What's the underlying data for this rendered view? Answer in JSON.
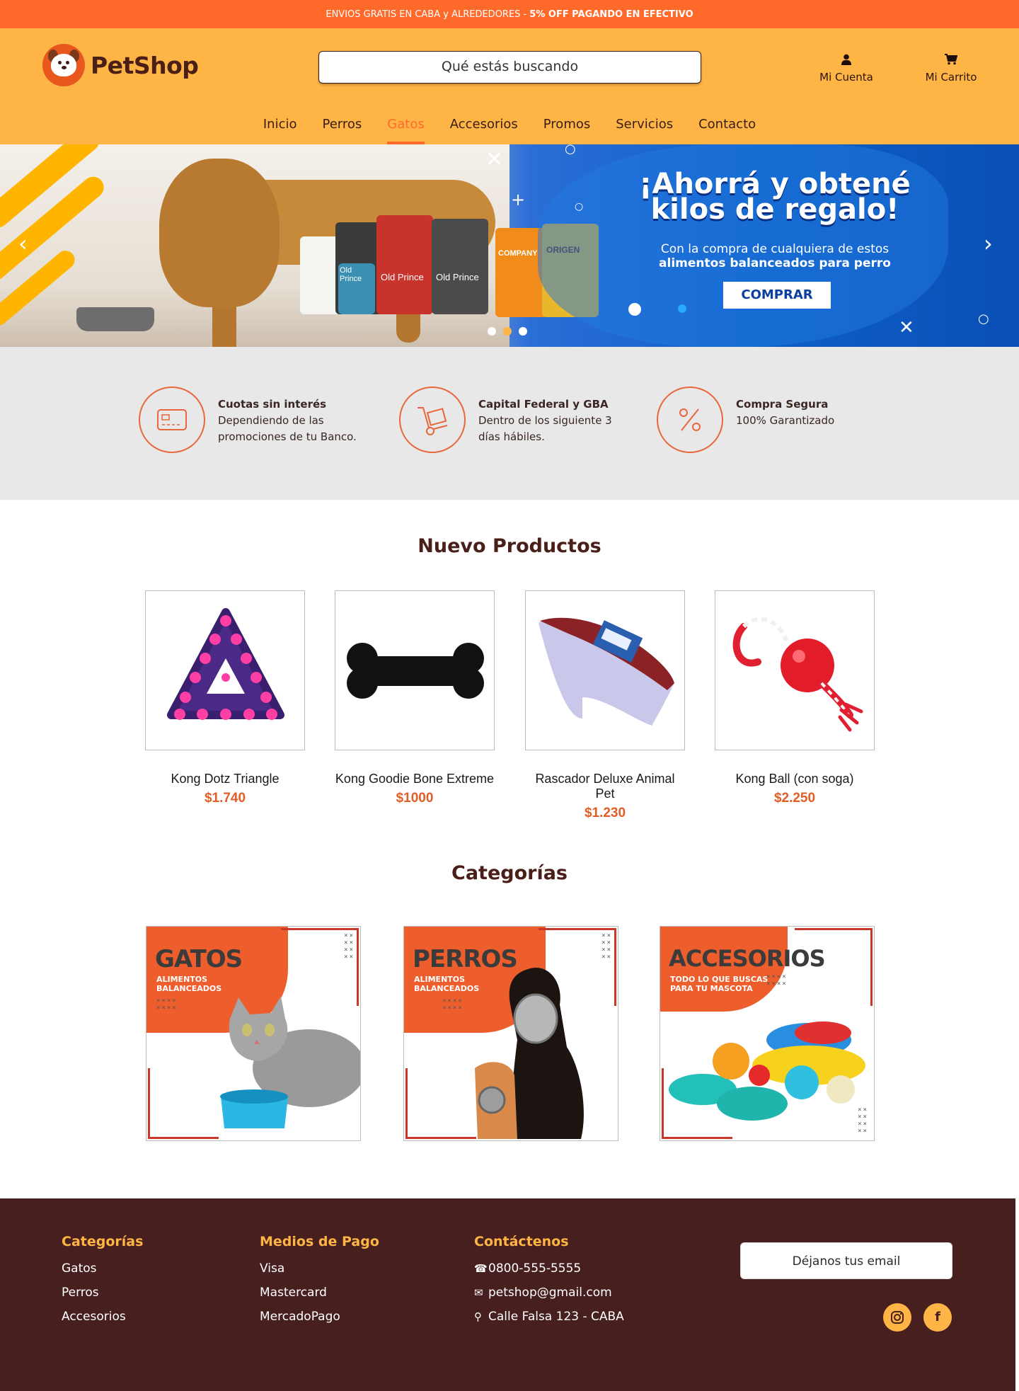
{
  "topbar": {
    "text": "ENVIOS GRATIS EN CABA y ALREDEDORES -",
    "bold": "5% OFF PAGANDO EN EFECTIVO"
  },
  "header": {
    "logo_text": "PetShop",
    "search_placeholder": "Qué estás buscando",
    "account_label": "Mi Cuenta",
    "cart_label": "Mi Carrito",
    "account_icon": "user-icon",
    "cart_icon": "shopping-cart-icon"
  },
  "nav": {
    "items": [
      {
        "label": "Inicio",
        "active": false
      },
      {
        "label": "Perros",
        "active": false
      },
      {
        "label": "Gatos",
        "active": true
      },
      {
        "label": "Accesorios",
        "active": false
      },
      {
        "label": "Promos",
        "active": false
      },
      {
        "label": "Servicios",
        "active": false
      },
      {
        "label": "Contacto",
        "active": false
      }
    ]
  },
  "banner": {
    "headline": "¡Ahorrá y obtené kilos de regalo!",
    "subline": "Con la compra de cualquiera de estos",
    "subline_bold": "alimentos balanceados para perro",
    "button": "COMPRAR",
    "prev_icon": "chevron-left-icon",
    "next_icon": "chevron-right-icon",
    "slides": 3,
    "active_slide": 2,
    "bag_labels": [
      "Old Prince",
      "Old Prince",
      "Old Prince",
      "COMPANY",
      "ORIGEN"
    ]
  },
  "features": [
    {
      "title": "Cuotas sin interés",
      "line1": "Dependiendo de las",
      "line2": "promociones de tu Banco.",
      "icon": "credit-card-icon"
    },
    {
      "title": "Capital Federal y GBA",
      "line1": "Dentro de los siguiente 3",
      "line2": "días hábiles.",
      "icon": "hand-truck-icon"
    },
    {
      "title": "Compra Segura",
      "line1": "100% Garantizado",
      "line2": "",
      "icon": "percent-icon"
    }
  ],
  "products": {
    "title": "Nuevo Productos",
    "items": [
      {
        "name": "Kong Dotz Triangle",
        "price": "$1.740"
      },
      {
        "name": "Kong Goodie Bone Extreme",
        "price": "$1000"
      },
      {
        "name": "Rascador Deluxe Animal Pet",
        "price": "$1.230"
      },
      {
        "name": "Kong Ball (con soga)",
        "price": "$2.250"
      }
    ]
  },
  "categories": {
    "title": "Categorías",
    "items": [
      {
        "big": "GATOS",
        "small": "ALIMENTOS BALANCEADOS"
      },
      {
        "big": "PERROS",
        "small": "ALIMENTOS BALANCEADOS"
      },
      {
        "big": "ACCESORIOS",
        "small": "TODO LO QUE BUSCAS PARA TU MASCOTA"
      }
    ]
  },
  "footer": {
    "cat_title": "Categorías",
    "cat_links": [
      "Gatos",
      "Perros",
      "Accesorios"
    ],
    "pay_title": "Medios de Pago",
    "pay_links": [
      "Visa",
      "Mastercard",
      "MercadoPago"
    ],
    "contact_title": "Contáctenos",
    "phone": "0800-555-5555",
    "email": "petshop@gmail.com",
    "address": "Calle Falsa 123 - CABA",
    "newsletter_placeholder": "Déjanos tus email",
    "social": [
      "instagram-icon",
      "facebook-icon"
    ]
  },
  "colors": {
    "topbar": "#ff6a2b",
    "header": "#ffb545",
    "accent": "#e35d27",
    "footer": "#471f1f",
    "features_bg": "#e8e8e8"
  }
}
